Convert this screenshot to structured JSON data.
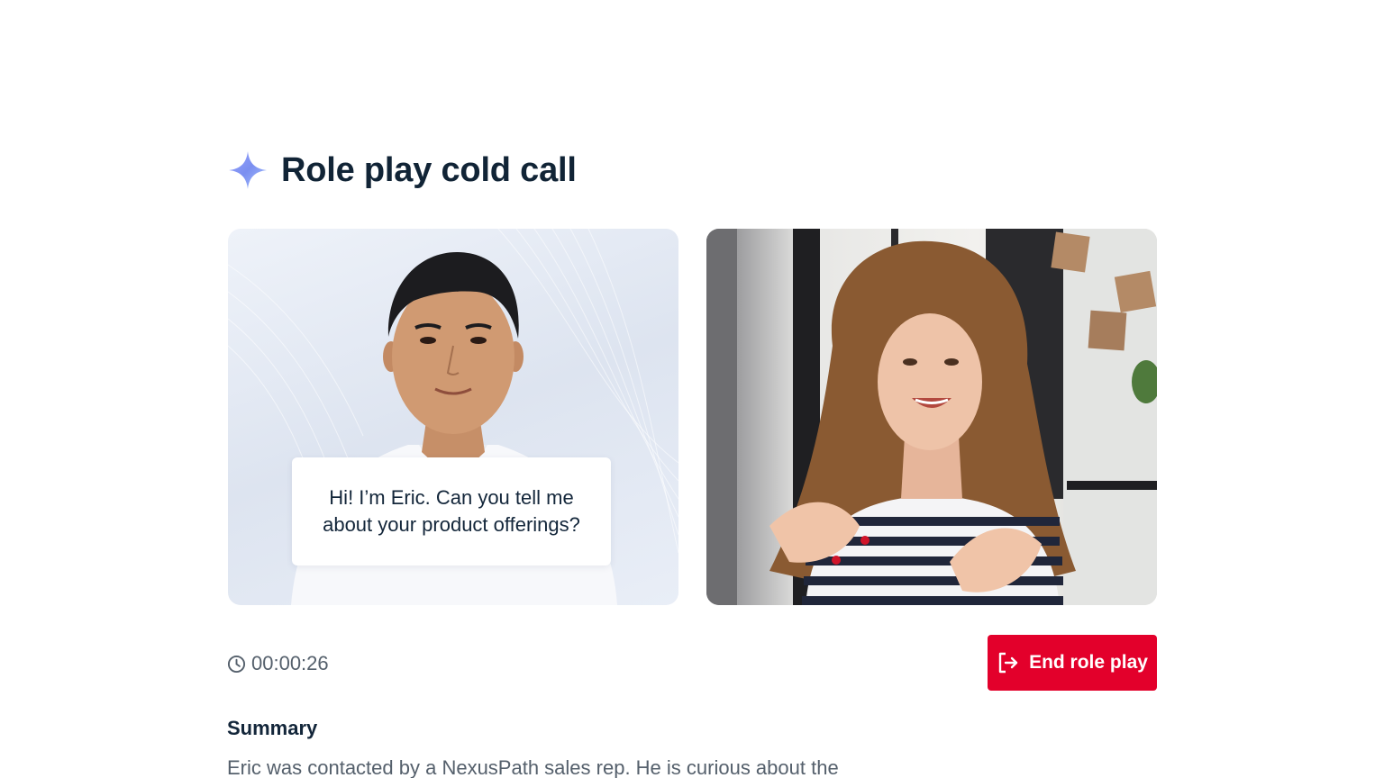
{
  "header": {
    "title": "Role play cold call",
    "icon": "sparkle-icon"
  },
  "ai_panel": {
    "speech_bubble": "Hi! I’m Eric. Can you tell me about your product offerings?"
  },
  "user_panel": {
    "camera": "user-camera-feed"
  },
  "controls": {
    "timer": "00:00:26",
    "timer_icon": "clock-icon",
    "end_button_label": "End role play",
    "end_button_icon": "exit-icon"
  },
  "summary": {
    "heading": "Summary",
    "text": "Eric was contacted by a NexusPath sales rep. He is curious about the"
  },
  "colors": {
    "accent_red": "#e3002b",
    "title_text": "#112436",
    "muted_text": "#55606c",
    "sparkle_blue": "#7b8ff0"
  }
}
